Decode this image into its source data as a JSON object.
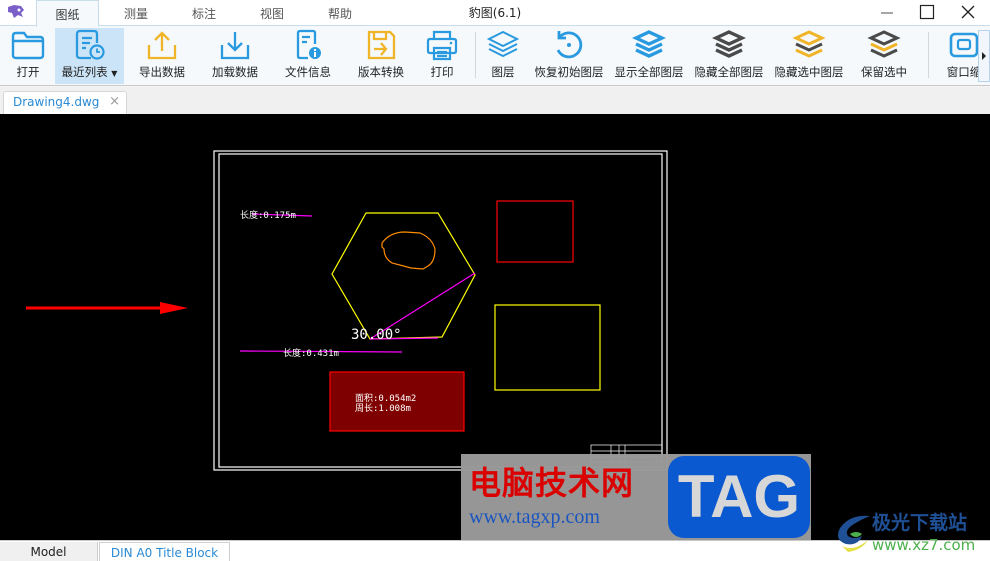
{
  "app": {
    "title": "豹图(6.1)",
    "logo_icon": "panther-logo-icon"
  },
  "menu_tabs": [
    {
      "label": "图纸",
      "active": true
    },
    {
      "label": "测量",
      "active": false
    },
    {
      "label": "标注",
      "active": false
    },
    {
      "label": "视图",
      "active": false
    },
    {
      "label": "帮助",
      "active": false
    }
  ],
  "window_controls": {
    "minimize": "minimize-icon",
    "maximize": "maximize-icon",
    "close": "close-icon"
  },
  "ribbon": {
    "buttons": [
      {
        "label": "打开",
        "icon": "folder-icon"
      },
      {
        "label": "最近列表",
        "icon": "recent-list-icon",
        "active": true,
        "dropdown": true
      },
      {
        "label": "导出数据",
        "icon": "export-icon"
      },
      {
        "label": "加载数据",
        "icon": "download-icon"
      },
      {
        "label": "文件信息",
        "icon": "file-info-icon"
      },
      {
        "label": "版本转换",
        "icon": "version-convert-icon"
      },
      {
        "label": "打印",
        "icon": "printer-icon"
      },
      {
        "label": "图层",
        "icon": "layers-icon"
      },
      {
        "label": "恢复初始图层",
        "icon": "restore-layers-icon"
      },
      {
        "label": "显示全部图层",
        "icon": "show-all-layers-icon"
      },
      {
        "label": "隐藏全部图层",
        "icon": "hide-all-layers-icon"
      },
      {
        "label": "隐藏选中图层",
        "icon": "hide-selected-layer-icon"
      },
      {
        "label": "保留选中",
        "icon": "keep-selected-icon"
      },
      {
        "label": "窗口缩",
        "icon": "window-zoom-icon"
      }
    ],
    "colors": {
      "blue": "#2a9ae0",
      "gold": "#f0b429",
      "dark": "#4a4a4a",
      "active_bg": "#cce4f7"
    }
  },
  "document_tabs": [
    {
      "label": "Drawing4.dwg",
      "close": "×"
    }
  ],
  "drawing": {
    "length_label_1": "长度:0.175m",
    "length_label_2": "长度:0.431m",
    "angle_label": "30.00°",
    "area_label": "面积:0.054m2",
    "perimeter_label": "周长:1.008m",
    "colors": {
      "background": "#000000",
      "frame": "#ffffff",
      "hexagon": "#ffff00",
      "blob": "#ff8c00",
      "measure": "#ff00ff",
      "red_rect": "#ff0000",
      "yellow_rect": "#ffff00",
      "area_fill": "#7f0000",
      "area_border": "#ff0000",
      "arrow": "#ff0000"
    }
  },
  "layout_tabs": [
    {
      "label": "Model",
      "active": false
    },
    {
      "label": "DIN A0 Title Block",
      "active": true
    }
  ],
  "watermarks": {
    "site1_name": "电脑技术网",
    "site1_url": "www.tagxp.com",
    "site1_badge": "TAG",
    "site2_name": "极光下载站",
    "site2_url": "www.xz7.com"
  }
}
